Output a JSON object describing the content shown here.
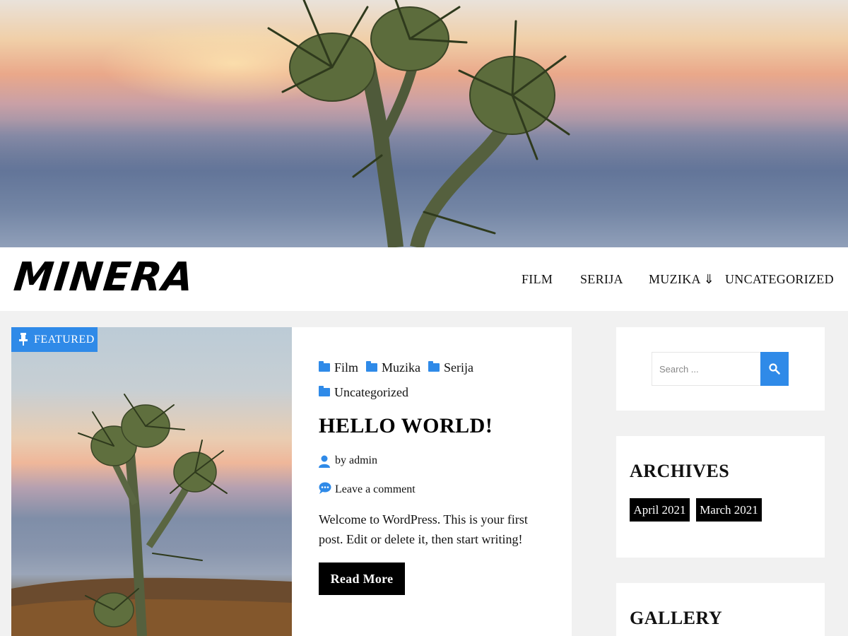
{
  "site": {
    "logo_text": "MINERA"
  },
  "nav": {
    "items": [
      {
        "label": "FILM"
      },
      {
        "label": "SERIJA"
      },
      {
        "label": "MUZIKA ⇓"
      },
      {
        "label": "UNCATEGORIZED"
      }
    ]
  },
  "post": {
    "badge": "FEATURED",
    "categories": [
      "Film",
      "Muzika",
      "Serija",
      "Uncategorized"
    ],
    "title": "HELLO WORLD!",
    "author": "by admin",
    "comments": "Leave a comment",
    "excerpt": "Welcome to WordPress. This is your first post. Edit or delete it, then start writing!",
    "read_more": "Read More"
  },
  "sidebar": {
    "search": {
      "placeholder": "Search ..."
    },
    "archives": {
      "title": "ARCHIVES",
      "items": [
        "April 2021",
        "March 2021"
      ]
    },
    "gallery": {
      "title": "GALLERY"
    }
  },
  "colors": {
    "accent": "#2f8ae8",
    "button_bg": "#000000",
    "page_bg": "#f1f1f1"
  },
  "icons": {
    "badge": "pin-icon",
    "category": "folder-icon",
    "author": "user-icon",
    "comment": "comment-icon",
    "search": "search-icon"
  }
}
